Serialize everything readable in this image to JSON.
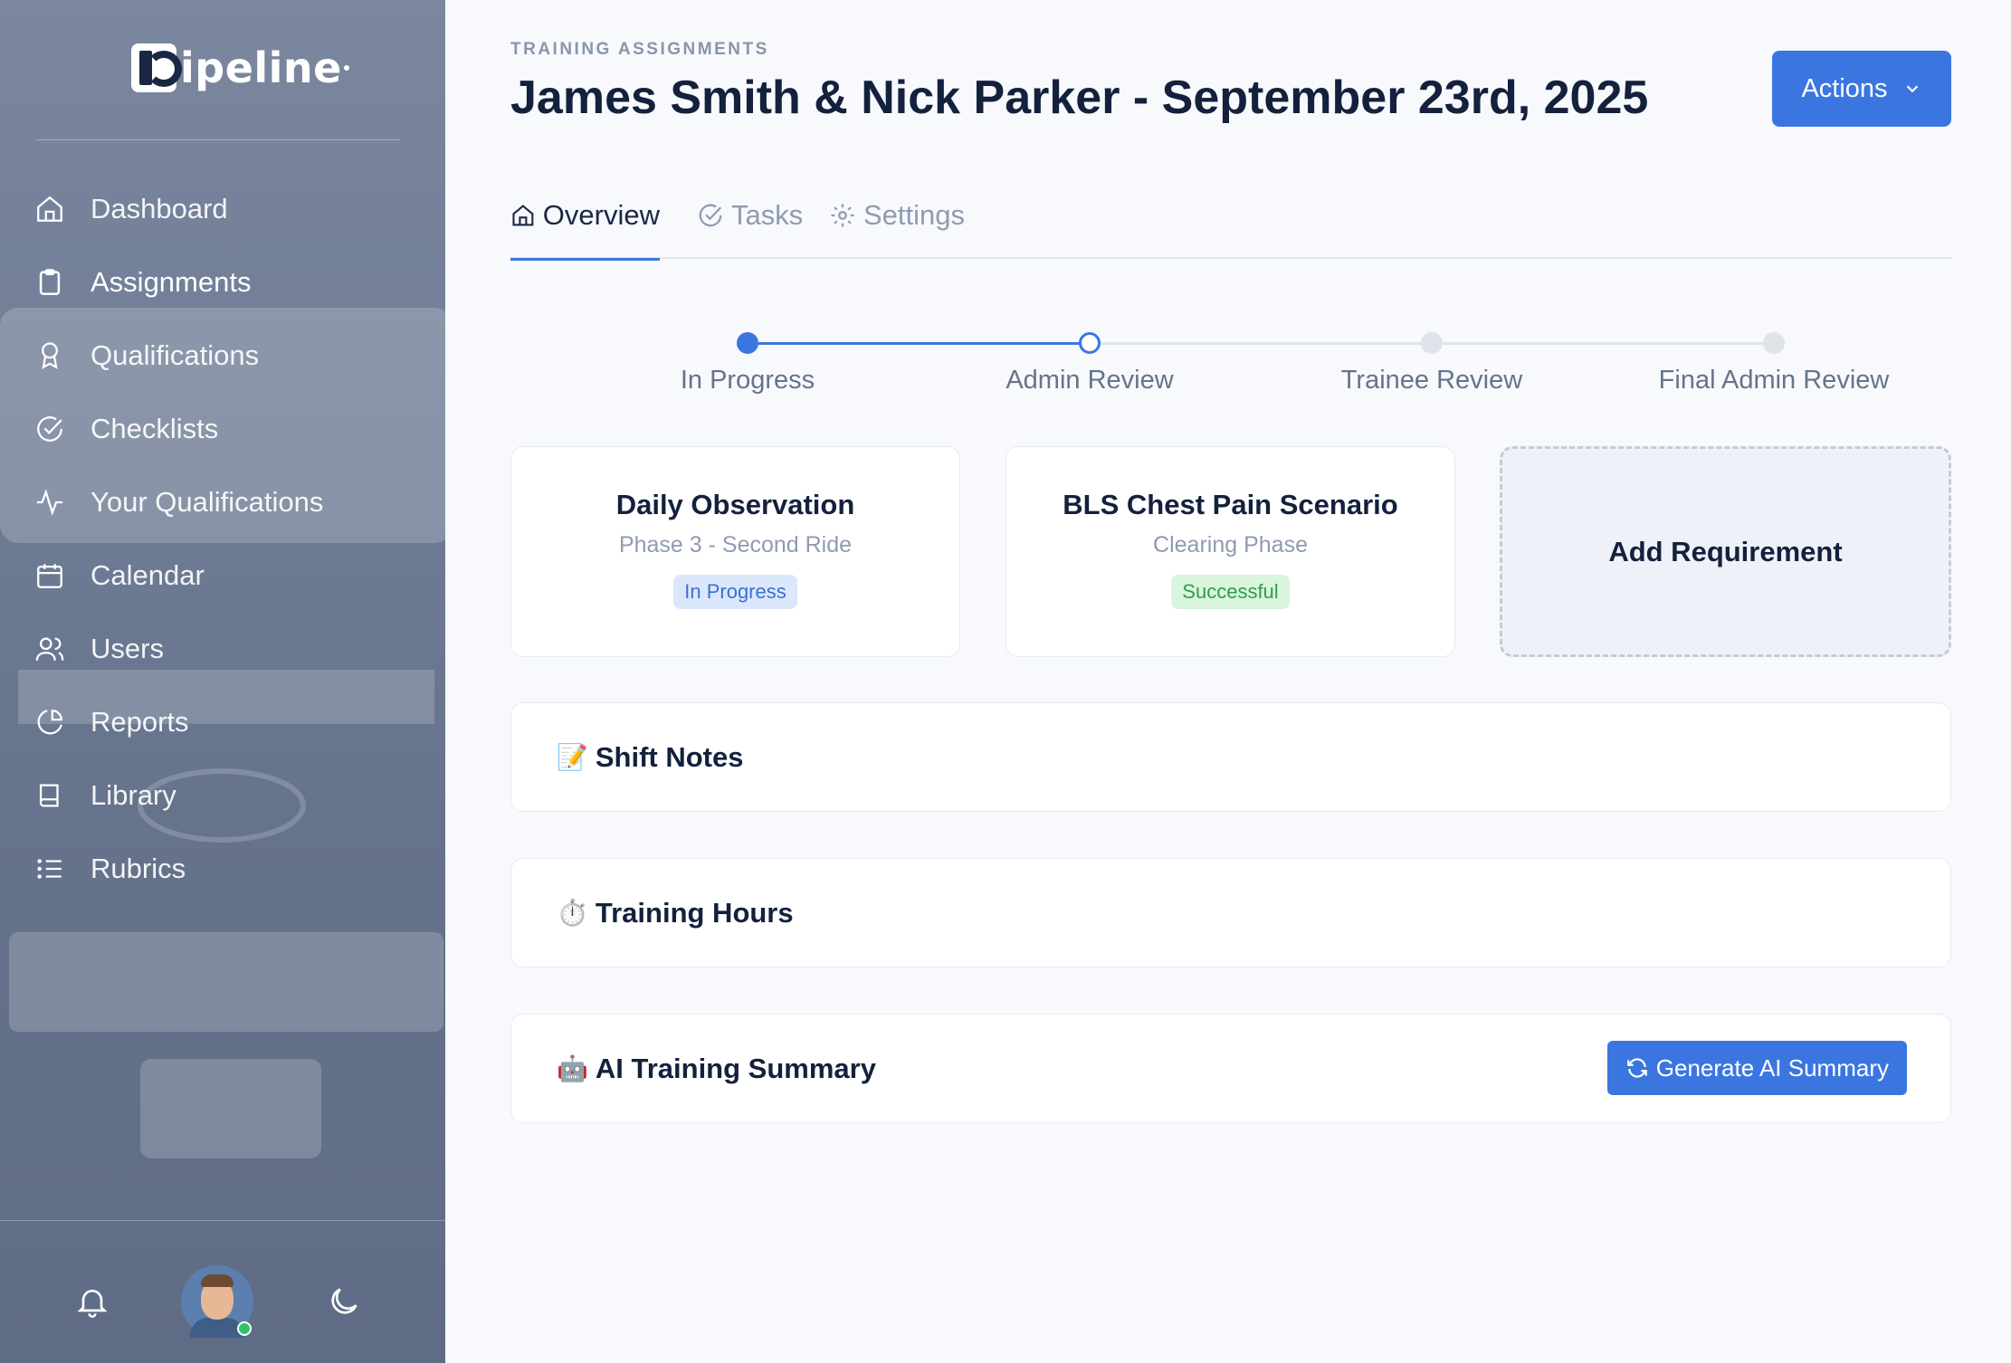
{
  "brand": {
    "name": "ipeline",
    "mark": "P"
  },
  "sidebar": {
    "items": [
      {
        "label": "Dashboard",
        "icon": "home-icon"
      },
      {
        "label": "Assignments",
        "icon": "clipboard-icon",
        "active": true
      },
      {
        "label": "Qualifications",
        "icon": "award-icon"
      },
      {
        "label": "Checklists",
        "icon": "check-circle-icon"
      },
      {
        "label": "Your Qualifications",
        "icon": "activity-icon"
      },
      {
        "label": "Calendar",
        "icon": "calendar-icon"
      },
      {
        "label": "Users",
        "icon": "users-icon"
      },
      {
        "label": "Reports",
        "icon": "pie-chart-icon"
      },
      {
        "label": "Library",
        "icon": "book-icon"
      },
      {
        "label": "Rubrics",
        "icon": "list-icon"
      }
    ],
    "footer": {
      "notifications_icon": "bell-icon",
      "theme_icon": "moon-icon",
      "avatar_status": "online"
    }
  },
  "header": {
    "eyebrow": "TRAINING ASSIGNMENTS",
    "title": "James Smith & Nick Parker - September 23rd, 2025",
    "actions_label": "Actions"
  },
  "tabs": [
    {
      "label": "Overview",
      "icon": "home-icon",
      "active": true
    },
    {
      "label": "Tasks",
      "icon": "check-circle-icon"
    },
    {
      "label": "Settings",
      "icon": "gear-icon"
    }
  ],
  "stepper": {
    "steps": [
      "In Progress",
      "Admin Review",
      "Trainee Review",
      "Final Admin Review"
    ],
    "current_index": 1,
    "colors": {
      "done": "#3b76e0",
      "pending": "#dfe3ea"
    }
  },
  "requirements": [
    {
      "title": "Daily Observation",
      "subtitle": "Phase 3 - Second Ride",
      "status": "In Progress"
    },
    {
      "title": "BLS Chest Pain Scenario",
      "subtitle": "Clearing Phase",
      "status": "Successful"
    }
  ],
  "add_requirement_label": "Add Requirement",
  "sections": {
    "shift_notes": {
      "emoji": "📝",
      "title": "Shift Notes"
    },
    "training_hours": {
      "emoji": "⏱️",
      "title": "Training Hours"
    },
    "ai_summary": {
      "emoji": "🤖",
      "title": "AI Training Summary",
      "button_label": "Generate AI Summary"
    }
  },
  "colors": {
    "accent": "#3b76e0",
    "title": "#14213d"
  }
}
